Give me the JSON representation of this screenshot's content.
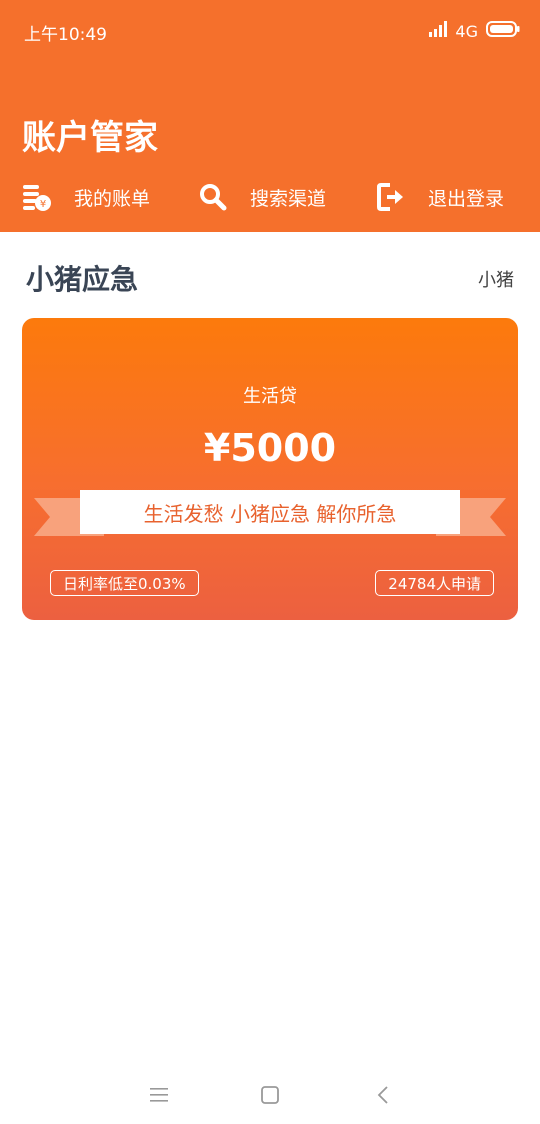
{
  "status_bar": {
    "time": "上午10:49",
    "network": "4G"
  },
  "header": {
    "title": "账户管家"
  },
  "toolbar": {
    "items": [
      {
        "label": "我的账单",
        "icon": "bill-icon"
      },
      {
        "label": "搜索渠道",
        "icon": "search-icon"
      },
      {
        "label": "退出登录",
        "icon": "logout-icon"
      }
    ]
  },
  "section": {
    "title": "小猪应急",
    "tag": "小猪"
  },
  "card": {
    "subtitle": "生活贷",
    "amount": "¥5000",
    "slogan": "生活发愁  小猪应急  解你所急",
    "rate": "日利率低至0.03%",
    "applicants": "24784人申请"
  },
  "colors": {
    "primary": "#f5702c",
    "card_top": "#fc7a0c",
    "card_bottom": "#ec6040",
    "title_text": "#3a4555"
  }
}
